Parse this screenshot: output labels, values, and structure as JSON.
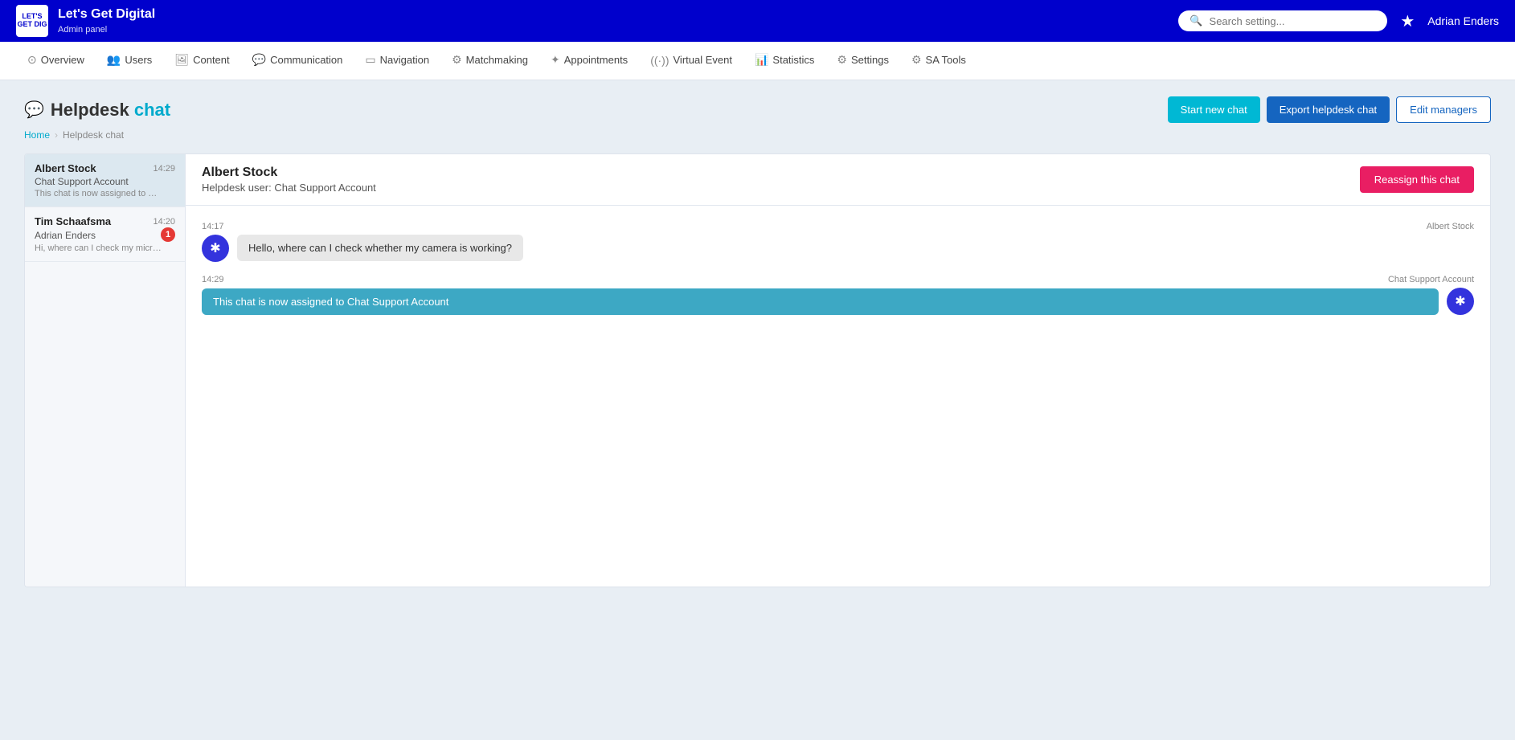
{
  "brand": {
    "logo_text": "LET'S GET DIG",
    "name": "Let's Get Digital",
    "subtitle": "Admin panel"
  },
  "topbar": {
    "search_placeholder": "Search setting...",
    "user_name": "Adrian Enders"
  },
  "secondnav": {
    "items": [
      {
        "id": "overview",
        "label": "Overview",
        "icon": "⊙"
      },
      {
        "id": "users",
        "label": "Users",
        "icon": "👥"
      },
      {
        "id": "content",
        "label": "Content",
        "icon": "🖼"
      },
      {
        "id": "communication",
        "label": "Communication",
        "icon": "💬"
      },
      {
        "id": "navigation",
        "label": "Navigation",
        "icon": "▭"
      },
      {
        "id": "matchmaking",
        "label": "Matchmaking",
        "icon": "⚙"
      },
      {
        "id": "appointments",
        "label": "Appointments",
        "icon": "✦"
      },
      {
        "id": "virtual-event",
        "label": "Virtual Event",
        "icon": "((·))"
      },
      {
        "id": "statistics",
        "label": "Statistics",
        "icon": "📊"
      },
      {
        "id": "settings",
        "label": "Settings",
        "icon": "⚙"
      },
      {
        "id": "sa-tools",
        "label": "SA Tools",
        "icon": "⚙"
      }
    ]
  },
  "page": {
    "title_part1": "Helpdesk",
    "title_part2": "chat",
    "breadcrumb_home": "Home",
    "breadcrumb_current": "Helpdesk chat"
  },
  "buttons": {
    "start_new": "Start new chat",
    "export": "Export helpdesk chat",
    "edit_managers": "Edit managers",
    "reassign": "Reassign this chat"
  },
  "chat_list": [
    {
      "name": "Albert Stock",
      "time": "14:29",
      "sub": "Chat Support Account",
      "preview": "This chat is now assigned to Chat Sup...",
      "active": true,
      "badge": null
    },
    {
      "name": "Tim Schaafsma",
      "time": "14:20",
      "sub": "Adrian Enders",
      "preview": "Hi, where can I check my microphone?",
      "active": false,
      "badge": "1"
    }
  ],
  "chat_detail": {
    "user_name": "Albert Stock",
    "user_sub": "Helpdesk user: Chat Support Account",
    "messages": [
      {
        "time": "14:17",
        "sender_label": "Albert Stock",
        "side": "left",
        "text": "Hello, where can I check whether my camera is working?"
      },
      {
        "time": "14:29",
        "sender_label": "Chat Support Account",
        "side": "right",
        "text": "This chat is now assigned to Chat Support Account"
      }
    ]
  }
}
